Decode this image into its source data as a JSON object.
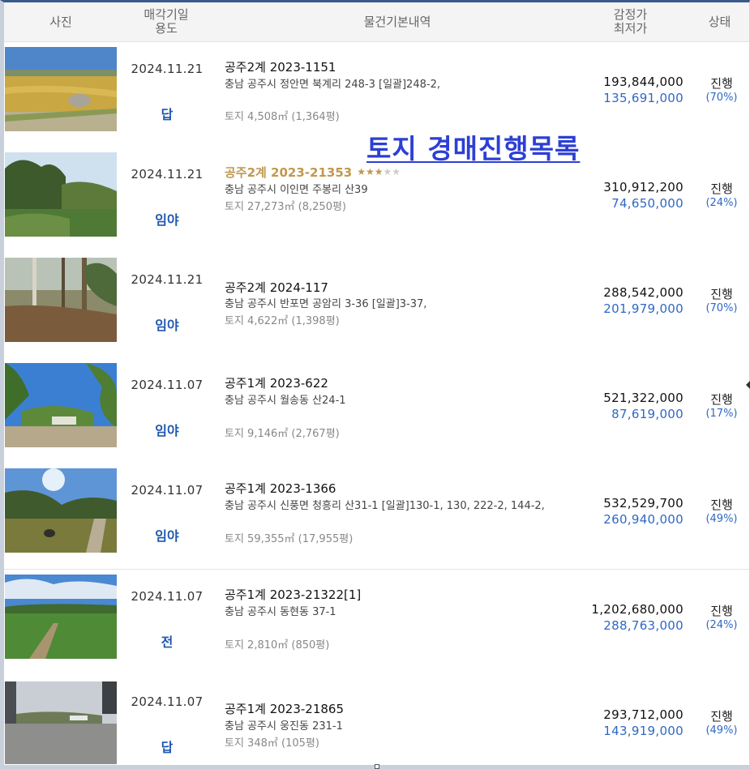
{
  "header": {
    "photo": "사진",
    "date_line1": "매각기일",
    "date_line2": "용도",
    "info": "물건기본내역",
    "price_line1": "감정가",
    "price_line2": "최저가",
    "status": "상태"
  },
  "overlay_title": "토지  경매진행목록",
  "items": [
    {
      "photo_icon": "field-photo-icon",
      "date": "2024.11.21",
      "usage": "답",
      "case_no": "공주2계 2023-1151",
      "address": "충남 공주시 정안면 북계리 248-3  [일괄]248-2,",
      "area": "토지 4,508㎡ (1,364평)",
      "appraisal": "193,844,000",
      "minimum": "135,691,000",
      "status": "진행",
      "percent": "(70%)"
    },
    {
      "photo_icon": "forest-photo-icon",
      "date": "2024.11.21",
      "usage": "임야",
      "case_no": "공주2계 2023-21353",
      "highlight": true,
      "stars": "★★★",
      "stars_off": "★★",
      "address": "충남 공주시 이인면 주봉리 산39",
      "area": "토지 27,273㎡ (8,250평)",
      "appraisal": "310,912,200",
      "minimum": "74,650,000",
      "status": "진행",
      "percent": "(24%)"
    },
    {
      "photo_icon": "forest-photo-icon",
      "date": "2024.11.21",
      "usage": "임야",
      "case_no": "공주2계 2024-117",
      "address": "충남 공주시 반포면 공암리 3-36  [일괄]3-37,",
      "area": "토지 4,622㎡ (1,398평)",
      "appraisal": "288,542,000",
      "minimum": "201,979,000",
      "status": "진행",
      "percent": "(70%)"
    },
    {
      "photo_icon": "hill-photo-icon",
      "date": "2024.11.07",
      "usage": "임야",
      "case_no": "공주1계 2023-622",
      "address": "충남 공주시 월송동 산24-1",
      "area": "토지 9,146㎡ (2,767평)",
      "appraisal": "521,322,000",
      "minimum": "87,619,000",
      "status": "진행",
      "percent": "(17%)"
    },
    {
      "photo_icon": "hill-photo-icon",
      "date": "2024.11.07",
      "usage": "임야",
      "case_no": "공주1계 2023-1366",
      "address": "충남 공주시 신풍면 청흥리 산31-1  [일괄]130-1, 130, 222-2, 144-2,",
      "area": "토지 59,355㎡ (17,955평)",
      "appraisal": "532,529,700",
      "minimum": "260,940,000",
      "status": "진행",
      "percent": "(49%)"
    },
    {
      "photo_icon": "field-photo-icon",
      "date": "2024.11.07",
      "usage": "전",
      "case_no": "공주1계 2023-21322[1]",
      "address": "충남 공주시 동현동 37-1",
      "area": "토지 2,810㎡ (850평)",
      "appraisal": "1,202,680,000",
      "minimum": "288,763,000",
      "status": "진행",
      "percent": "(24%)"
    },
    {
      "photo_icon": "lot-photo-icon",
      "date": "2024.11.07",
      "usage": "답",
      "case_no": "공주1계 2023-21865",
      "address": "충남 공주시 웅진동 231-1",
      "area": "토지 348㎡ (105평)",
      "appraisal": "293,712,000",
      "minimum": "143,919,000",
      "status": "진행",
      "percent": "(49%)"
    }
  ]
}
